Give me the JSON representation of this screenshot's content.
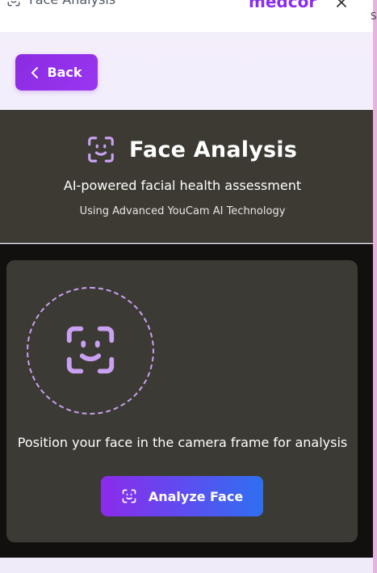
{
  "header": {
    "title": "Face Analysis",
    "brand": "medcor",
    "title_icon": "face-scan-icon",
    "close_icon": "close-icon",
    "edge_glyph": "S"
  },
  "back_button": {
    "label": "Back",
    "icon": "chevron-left-icon"
  },
  "hero": {
    "title": "Face Analysis",
    "subtitle": "AI-powered facial health assessment",
    "tech_note": "Using Advanced YouCam AI Technology",
    "icon": "face-scan-icon"
  },
  "card": {
    "instruction": "Position your face in the camera frame for analysis",
    "frame_icon": "face-scan-icon",
    "analyze_label": "Analyze Face",
    "analyze_icon": "face-scan-icon"
  },
  "colors": {
    "accent_purple": "#8a2be2",
    "accent_blue": "#2f6ff0",
    "icon_lavender": "#c9a1f1",
    "dark_bg": "#3c3a33"
  }
}
